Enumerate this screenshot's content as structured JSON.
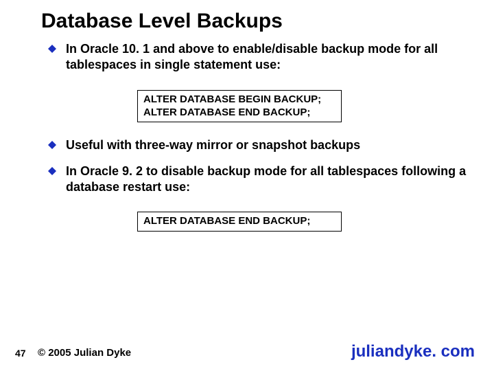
{
  "title": "Database Level Backups",
  "bullets": [
    {
      "text": "In Oracle 10. 1 and above to enable/disable backup mode for all tablespaces in single statement use:"
    },
    {
      "text": "Useful with three-way mirror or snapshot backups"
    },
    {
      "text": "In Oracle 9. 2 to disable backup mode for all tablespaces following a database restart use:"
    }
  ],
  "code_box_1": "ALTER DATABASE BEGIN BACKUP;\nALTER DATABASE END BACKUP;",
  "code_box_2": "ALTER DATABASE END BACKUP;",
  "footer": {
    "page": "47",
    "copyright": "© 2005 Julian Dyke",
    "site": "juliandyke. com"
  },
  "colors": {
    "bullet": "#1a2fbf",
    "site": "#1a2fbf"
  }
}
